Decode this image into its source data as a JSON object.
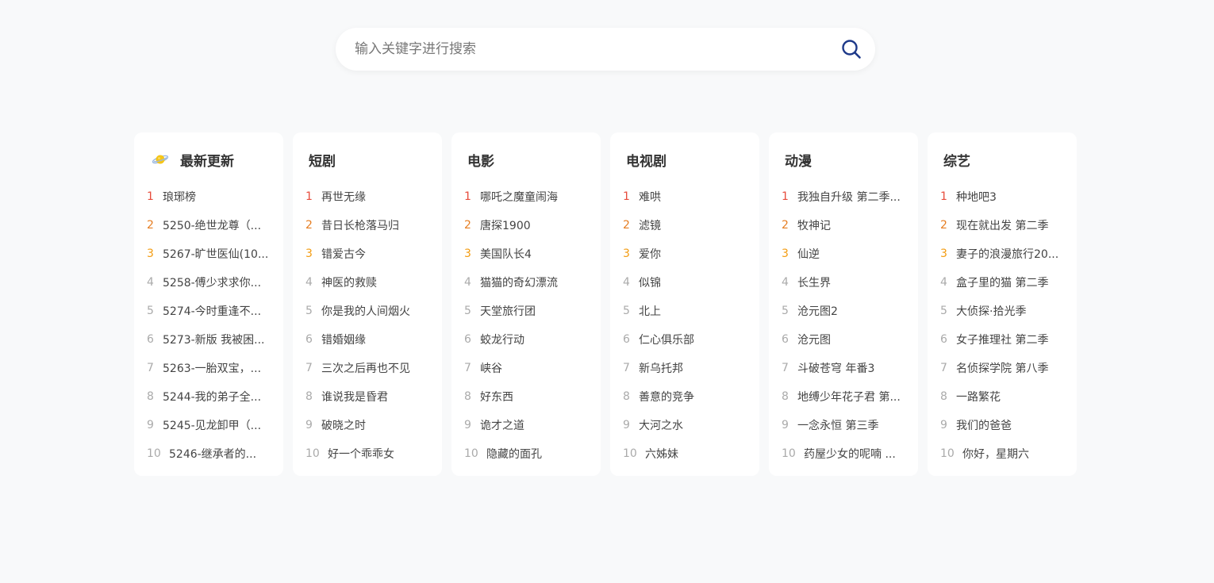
{
  "search": {
    "placeholder": "输入关键字进行搜索",
    "icon": "search-icon",
    "icon_color": "#1e3a8a"
  },
  "rank_colors": [
    "#e74c3c",
    "#e67e22",
    "#f39c12",
    "#aaaaaa"
  ],
  "columns": [
    {
      "title": "最新更新",
      "icon": "planet-icon",
      "items": [
        {
          "rank": "1",
          "title": "琅琊榜"
        },
        {
          "rank": "2",
          "title": "5250-绝世龙尊（..."
        },
        {
          "rank": "3",
          "title": "5267-旷世医仙(10..."
        },
        {
          "rank": "4",
          "title": "5258-傅少求求你..."
        },
        {
          "rank": "5",
          "title": "5274-今时重逢不..."
        },
        {
          "rank": "6",
          "title": "5273-新版 我被困..."
        },
        {
          "rank": "7",
          "title": "5263-一胎双宝，..."
        },
        {
          "rank": "8",
          "title": "5244-我的弟子全..."
        },
        {
          "rank": "9",
          "title": "5245-见龙卸甲（..."
        },
        {
          "rank": "10",
          "title": "5246-继承者的..."
        }
      ]
    },
    {
      "title": "短剧",
      "items": [
        {
          "rank": "1",
          "title": "再世无缘"
        },
        {
          "rank": "2",
          "title": "昔日长枪落马归"
        },
        {
          "rank": "3",
          "title": "错爱古今"
        },
        {
          "rank": "4",
          "title": "神医的救赎"
        },
        {
          "rank": "5",
          "title": "你是我的人间烟火"
        },
        {
          "rank": "6",
          "title": "错婚姻缘"
        },
        {
          "rank": "7",
          "title": "三次之后再也不见"
        },
        {
          "rank": "8",
          "title": "谁说我是昏君"
        },
        {
          "rank": "9",
          "title": "破晓之时"
        },
        {
          "rank": "10",
          "title": "好一个乖乖女"
        }
      ]
    },
    {
      "title": "电影",
      "items": [
        {
          "rank": "1",
          "title": "哪吒之魔童闹海"
        },
        {
          "rank": "2",
          "title": "唐探1900"
        },
        {
          "rank": "3",
          "title": "美国队长4"
        },
        {
          "rank": "4",
          "title": "猫猫的奇幻漂流"
        },
        {
          "rank": "5",
          "title": "天堂旅行团"
        },
        {
          "rank": "6",
          "title": "蛟龙行动"
        },
        {
          "rank": "7",
          "title": "峡谷"
        },
        {
          "rank": "8",
          "title": "好东西"
        },
        {
          "rank": "9",
          "title": "诡才之道"
        },
        {
          "rank": "10",
          "title": "隐藏的面孔"
        }
      ]
    },
    {
      "title": "电视剧",
      "items": [
        {
          "rank": "1",
          "title": "难哄"
        },
        {
          "rank": "2",
          "title": "滤镜"
        },
        {
          "rank": "3",
          "title": "爱你"
        },
        {
          "rank": "4",
          "title": "似锦"
        },
        {
          "rank": "5",
          "title": "北上"
        },
        {
          "rank": "6",
          "title": "仁心俱乐部"
        },
        {
          "rank": "7",
          "title": "新乌托邦"
        },
        {
          "rank": "8",
          "title": "善意的竞争"
        },
        {
          "rank": "9",
          "title": "大河之水"
        },
        {
          "rank": "10",
          "title": "六姊妹"
        }
      ]
    },
    {
      "title": "动漫",
      "items": [
        {
          "rank": "1",
          "title": "我独自升级 第二季..."
        },
        {
          "rank": "2",
          "title": "牧神记"
        },
        {
          "rank": "3",
          "title": "仙逆"
        },
        {
          "rank": "4",
          "title": "长生界"
        },
        {
          "rank": "5",
          "title": "沧元图2"
        },
        {
          "rank": "6",
          "title": "沧元图"
        },
        {
          "rank": "7",
          "title": "斗破苍穹 年番3"
        },
        {
          "rank": "8",
          "title": "地缚少年花子君 第..."
        },
        {
          "rank": "9",
          "title": "一念永恒 第三季"
        },
        {
          "rank": "10",
          "title": "药屋少女的呢喃 ..."
        }
      ]
    },
    {
      "title": "综艺",
      "items": [
        {
          "rank": "1",
          "title": "种地吧3"
        },
        {
          "rank": "2",
          "title": "现在就出发 第二季"
        },
        {
          "rank": "3",
          "title": "妻子的浪漫旅行20..."
        },
        {
          "rank": "4",
          "title": "盒子里的猫 第二季"
        },
        {
          "rank": "5",
          "title": "大侦探·拾光季"
        },
        {
          "rank": "6",
          "title": "女子推理社 第二季"
        },
        {
          "rank": "7",
          "title": "名侦探学院 第八季"
        },
        {
          "rank": "8",
          "title": "一路繁花"
        },
        {
          "rank": "9",
          "title": "我们的爸爸"
        },
        {
          "rank": "10",
          "title": "你好，星期六"
        }
      ]
    }
  ]
}
